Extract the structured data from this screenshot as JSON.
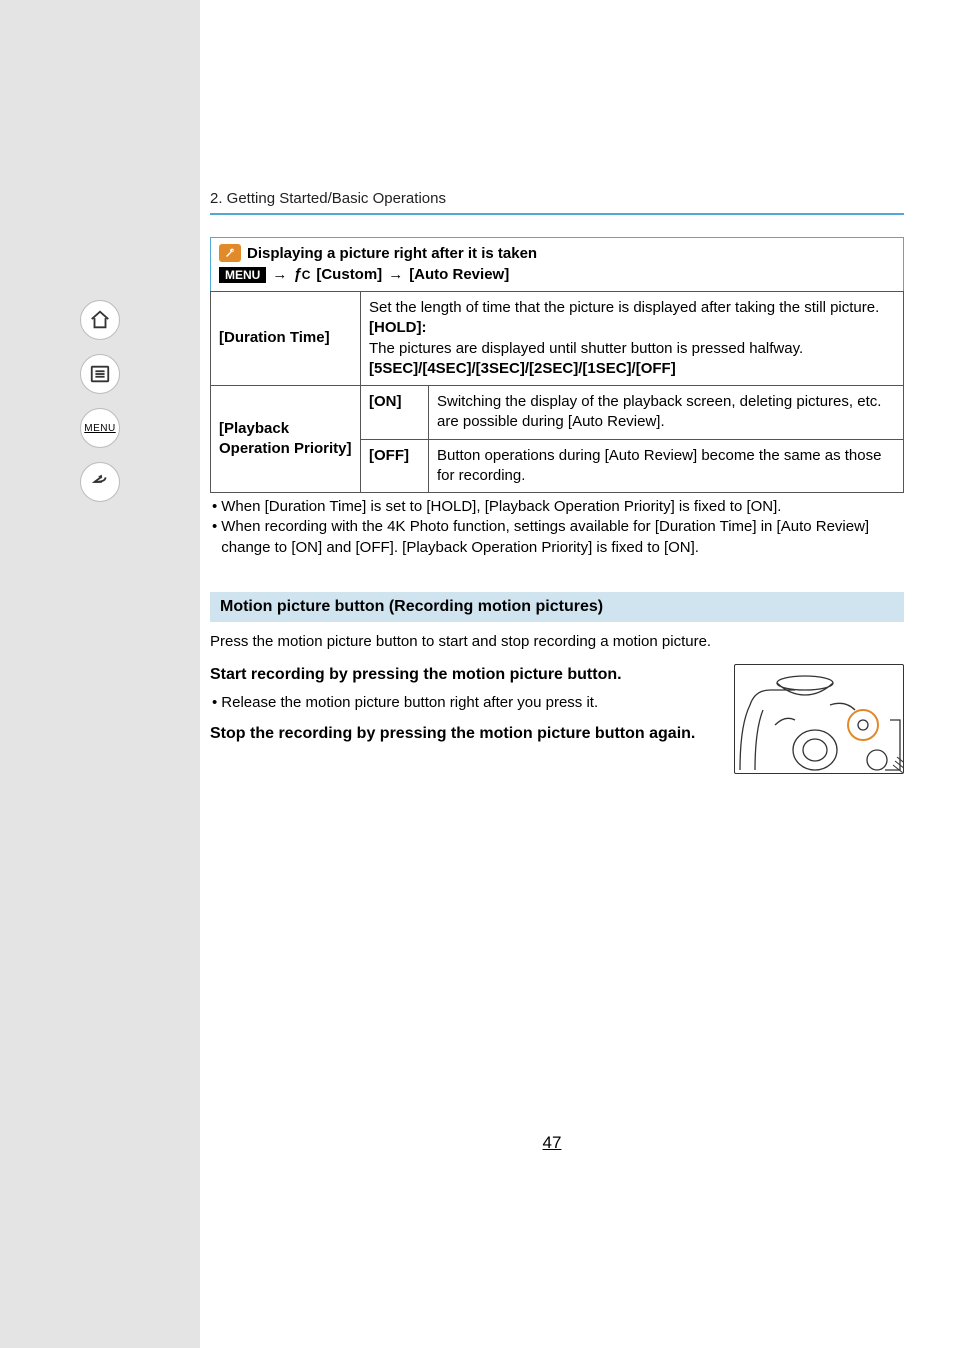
{
  "breadcrumb": "2. Getting Started/Basic Operations",
  "callout": {
    "title": "Displaying a picture right after it is taken",
    "menu_badge": "MENU",
    "arrow": "→",
    "fc": "C",
    "custom": "[Custom]",
    "auto_review": "[Auto Review]"
  },
  "table": {
    "row1_label": "[Duration Time]",
    "row1_desc_line1": "Set the length of time that the picture is displayed after taking the still picture.",
    "row1_desc_hold": "[HOLD]:",
    "row1_desc_line2": "The pictures are displayed until shutter button is pressed halfway.",
    "row1_desc_opts": "[5SEC]/[4SEC]/[3SEC]/[2SEC]/[1SEC]/[OFF]",
    "row2_label": "[Playback Operation Priority]",
    "row2_on": "[ON]",
    "row2_on_desc": "Switching the display of the playback screen, deleting pictures, etc. are possible during [Auto Review].",
    "row2_off": "[OFF]",
    "row2_off_desc": "Button operations during [Auto Review] become the same as those for recording."
  },
  "notes": {
    "n1": "When [Duration Time] is set to [HOLD], [Playback Operation Priority] is fixed to [ON].",
    "n2": "When recording with the 4K Photo function, settings available for [Duration Time] in [Auto Review] change to [ON] and [OFF]. [Playback Operation Priority] is fixed to [ON]."
  },
  "section_head": "Motion picture button (Recording motion pictures)",
  "intro": "Press the motion picture button to start and stop recording a motion picture.",
  "start_title": "Start recording by pressing the motion picture button.",
  "release_note": "Release the motion picture button right after you press it.",
  "stop_title": "Stop the recording by pressing the motion picture button again.",
  "page_number": "47",
  "nav": {
    "home": "home-icon",
    "toc": "toc-icon",
    "menu": "MENU",
    "back": "back-icon"
  }
}
